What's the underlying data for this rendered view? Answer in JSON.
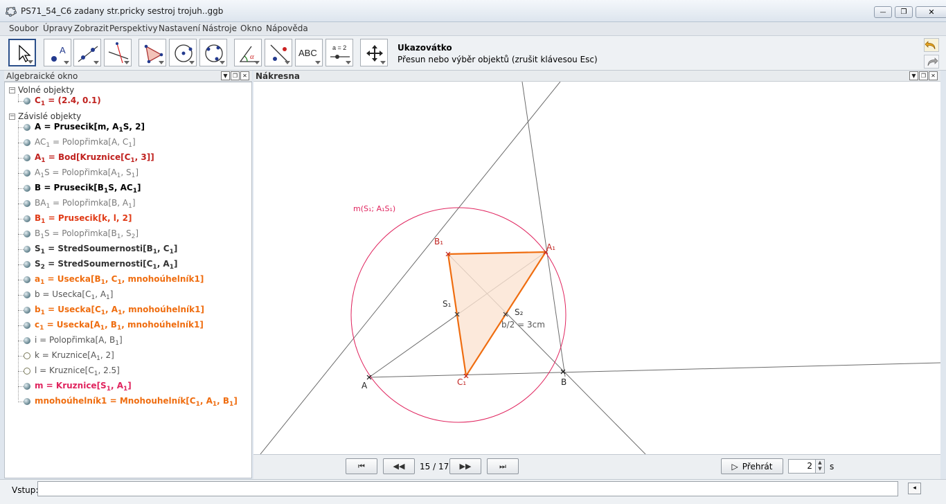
{
  "window": {
    "title": "PS71_54_C6 zadany str.pricky sestroj trojuh..ggb",
    "minimize_glyph": "—",
    "maximize_glyph": "❐",
    "close_glyph": "✕"
  },
  "menu": [
    "Soubor",
    "Úpravy",
    "Zobrazit",
    "Perspektivy",
    "Nastavení",
    "Nástroje",
    "Okno",
    "Nápověda"
  ],
  "toolbar": {
    "tool_name": "Ukazovátko",
    "tool_help": "Přesun nebo výběr objektů (zrušit klávesou Esc)",
    "text_tool_label": "ABC",
    "slider_tool_label": "a = 2",
    "tool_icons": [
      "pointer-icon",
      "point-icon",
      "line-icon",
      "perpendicular-icon",
      "polygon-icon",
      "circle-icon",
      "circle-3pts-icon",
      "angle-icon",
      "reflect-icon",
      "text-icon",
      "slider-icon",
      "move-view-icon"
    ]
  },
  "algebra": {
    "title": "Algebraické okno",
    "free_header": "Volné objekty",
    "dependent_header": "Závislé objekty",
    "free_items": [
      {
        "html": "C<sub>1</sub> = (2.4, 0.1)",
        "color": "#c0221f",
        "bold": true,
        "hollow": false
      }
    ],
    "dependent_items": [
      {
        "html": "A = Prusecik[m, A<sub>1</sub>S, 2]",
        "color": "#000000",
        "bold": true,
        "hollow": false
      },
      {
        "html": "AC<sub>1</sub> = Polopřimka[A, C<sub>1</sub>]",
        "color": "#7a7a7a",
        "bold": false,
        "hollow": false
      },
      {
        "html": "A<sub>1</sub> = Bod[Kruznice[C<sub>1</sub>, 3]]",
        "color": "#c0221f",
        "bold": true,
        "hollow": false
      },
      {
        "html": "A<sub>1</sub>S = Polopřimka[A<sub>1</sub>, S<sub>1</sub>]",
        "color": "#7a7a7a",
        "bold": false,
        "hollow": false
      },
      {
        "html": "B = Prusecik[B<sub>1</sub>S, AC<sub>1</sub>]",
        "color": "#000000",
        "bold": true,
        "hollow": false
      },
      {
        "html": "BA<sub>1</sub> = Polopřimka[B, A<sub>1</sub>]",
        "color": "#7a7a7a",
        "bold": false,
        "hollow": false
      },
      {
        "html": "B<sub>1</sub> = Prusecik[k, l, 2]",
        "color": "#e03a16",
        "bold": true,
        "hollow": false
      },
      {
        "html": "B<sub>1</sub>S = Polopřimka[B<sub>1</sub>, S<sub>2</sub>]",
        "color": "#7a7a7a",
        "bold": false,
        "hollow": false
      },
      {
        "html": "S<sub>1</sub> = StredSoumernosti[B<sub>1</sub>, C<sub>1</sub>]",
        "color": "#333333",
        "bold": true,
        "hollow": false
      },
      {
        "html": "S<sub>2</sub> = StredSoumernosti[C<sub>1</sub>, A<sub>1</sub>]",
        "color": "#333333",
        "bold": true,
        "hollow": false
      },
      {
        "html": "a<sub>1</sub> = Usecka[B<sub>1</sub>, C<sub>1</sub>, mnohoúhelník1]",
        "color": "#ef6d10",
        "bold": true,
        "hollow": false
      },
      {
        "html": "b = Usecka[C<sub>1</sub>, A<sub>1</sub>]",
        "color": "#555555",
        "bold": false,
        "hollow": false
      },
      {
        "html": "b<sub>1</sub> = Usecka[C<sub>1</sub>, A<sub>1</sub>, mnohoúhelník1]",
        "color": "#ef6d10",
        "bold": true,
        "hollow": false
      },
      {
        "html": "c<sub>1</sub> = Usecka[A<sub>1</sub>, B<sub>1</sub>, mnohoúhelník1]",
        "color": "#ef6d10",
        "bold": true,
        "hollow": false
      },
      {
        "html": "i = Polopřimka[A, B<sub>1</sub>]",
        "color": "#555555",
        "bold": false,
        "hollow": false
      },
      {
        "html": "k = Kruznice[A<sub>1</sub>, 2]",
        "color": "#555555",
        "bold": false,
        "hollow": true
      },
      {
        "html": "l = Kruznice[C<sub>1</sub>, 2.5]",
        "color": "#555555",
        "bold": false,
        "hollow": true
      },
      {
        "html": "m = Kruznice[S<sub>1</sub>, A<sub>1</sub>]",
        "color": "#e0245e",
        "bold": true,
        "hollow": false
      },
      {
        "html": "mnohoúhelník1 = Mnohouhelník[C<sub>1</sub>, A<sub>1</sub>, B<sub>1</sub>]",
        "color": "#ef6d10",
        "bold": true,
        "hollow": false
      }
    ]
  },
  "graphics": {
    "title": "Nákresna",
    "labels": {
      "circle": "m(S₁; A₁S₁)",
      "B1": "B₁",
      "A1": "A₁",
      "S1": "S₁",
      "S2": "S₂",
      "C1": "C₁",
      "A": "A",
      "B": "B",
      "dist": "b/2 = 3cm"
    },
    "colors": {
      "circle": "#e0245e",
      "triangle_stroke": "#ef6d10",
      "triangle_fill": "#fbe3d2",
      "lines": "#666666",
      "point_label_red": "#c0221f",
      "point_label_dark": "#333333"
    }
  },
  "navigation": {
    "first_label": "⏮",
    "prev_label": "◀◀",
    "frame": "15 / 17",
    "next_label": "▶▶",
    "last_label": "⏭",
    "play_label": "Přehrát",
    "play_icon": "▷",
    "speed": "2",
    "speed_unit": "s"
  },
  "input": {
    "label": "Vstup:",
    "value": "",
    "help_glyph": "◂"
  }
}
